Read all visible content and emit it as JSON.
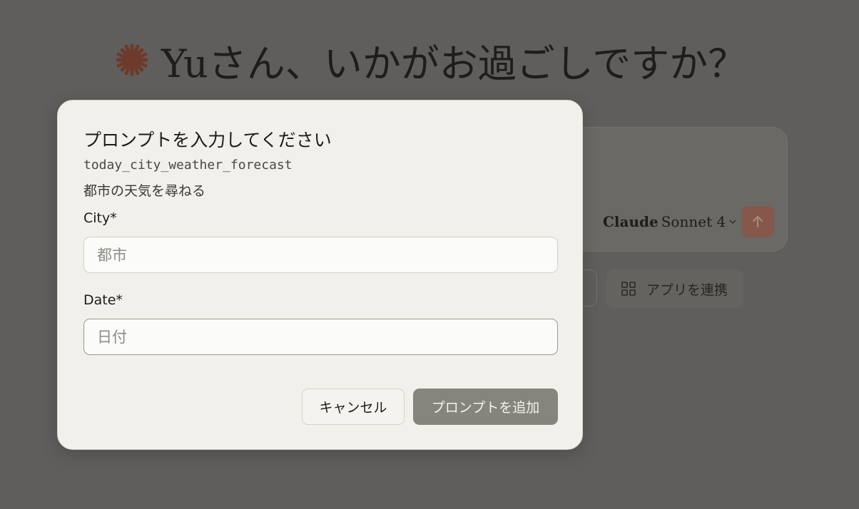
{
  "background": {
    "greeting": "Yuさん、いかがお過ごしですか？",
    "composer": {
      "model_brand": "Claude",
      "model_name": "Sonnet 4",
      "send_icon": "arrow-up-icon"
    },
    "apps_chip": {
      "icon": "grid-icon",
      "label": "アプリを連携"
    },
    "accent_color": "#c15f3c"
  },
  "modal": {
    "title": "プロンプトを入力してください",
    "prompt_id": "today_city_weather_forecast",
    "description": "都市の天気を尋ねる",
    "fields": [
      {
        "label": "City*",
        "value": "",
        "placeholder": "都市"
      },
      {
        "label": "Date*",
        "value": "",
        "placeholder": "日付"
      }
    ],
    "cancel_label": "キャンセル",
    "add_label": "プロンプトを追加"
  }
}
